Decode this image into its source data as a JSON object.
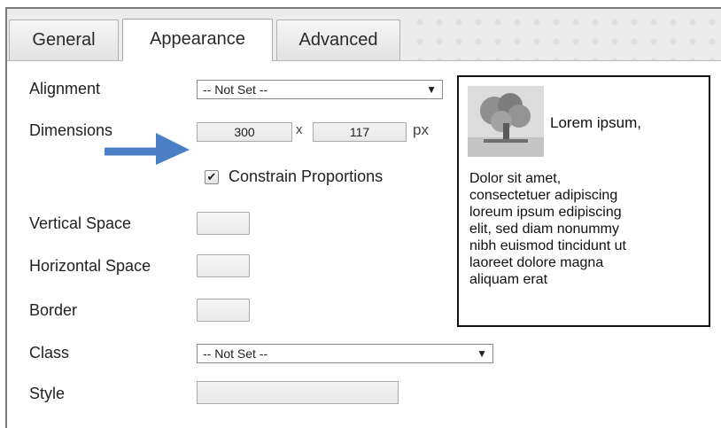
{
  "tabs": [
    {
      "label": "General",
      "active": false
    },
    {
      "label": "Appearance",
      "active": true
    },
    {
      "label": "Advanced",
      "active": false
    }
  ],
  "form": {
    "alignment": {
      "label": "Alignment",
      "value": "-- Not Set --"
    },
    "dimensions": {
      "label": "Dimensions",
      "width": "300",
      "separator": "x",
      "height": "117",
      "unit": "px"
    },
    "constrain": {
      "label": "Constrain Proportions",
      "checked": true
    },
    "vertical_space": {
      "label": "Vertical Space",
      "value": ""
    },
    "horizontal_space": {
      "label": "Horizontal Space",
      "value": ""
    },
    "border": {
      "label": "Border",
      "value": ""
    },
    "class": {
      "label": "Class",
      "value": "-- Not Set --"
    },
    "style": {
      "label": "Style",
      "value": ""
    }
  },
  "preview": {
    "caption": "Lorem ipsum,",
    "body_lines": [
      "Dolor sit amet,",
      "consectetuer adipiscing",
      "loreum ipsum edipiscing",
      "elit, sed diam nonummy",
      "nibh euismod tincidunt ut",
      "laoreet dolore magna",
      "aliquam erat"
    ]
  },
  "icons": {
    "dropdown_arrow": "▼",
    "check": "✔",
    "annotation": "arrow-pointer-icon",
    "thumbnail": "tree-image-icon"
  },
  "colors": {
    "annotation_arrow": "#4a7fc6"
  }
}
